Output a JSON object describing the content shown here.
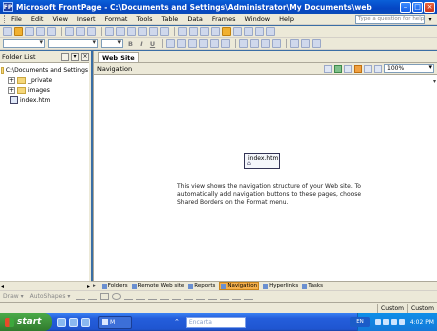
{
  "window": {
    "app_icon": "FP",
    "title": "Microsoft FrontPage - C:\\Documents and Settings\\Administrator\\My Documents\\web",
    "controls": [
      "minimize-icon",
      "maximize-icon",
      "close-icon"
    ]
  },
  "menubar": {
    "items": [
      "File",
      "Edit",
      "View",
      "Insert",
      "Format",
      "Tools",
      "Table",
      "Data",
      "Frames",
      "Window",
      "Help"
    ],
    "help_placeholder": "Type a question for help"
  },
  "folder_list": {
    "title": "Folder List",
    "items": [
      {
        "label": "C:\\Documents and Settings",
        "type": "folder",
        "expander": ""
      },
      {
        "label": "_private",
        "type": "folder",
        "expander": "+"
      },
      {
        "label": "images",
        "type": "folder",
        "expander": "+"
      },
      {
        "label": "index.htm",
        "type": "file",
        "expander": ""
      }
    ]
  },
  "document": {
    "tab_label": "Web Site",
    "view_label": "Navigation",
    "zoom": "100%",
    "nav_node_label": "index.htm",
    "message": "This view shows the navigation structure of your Web site. To automatically add navigation buttons to these pages, choose Shared Borders on the Format menu."
  },
  "view_tabs": [
    {
      "label": "Folders",
      "active": false
    },
    {
      "label": "Remote Web site",
      "active": false
    },
    {
      "label": "Reports",
      "active": false
    },
    {
      "label": "Navigation",
      "active": true
    },
    {
      "label": "Hyperlinks",
      "active": false
    },
    {
      "label": "Tasks",
      "active": false
    }
  ],
  "drawing_bar": {
    "draw_label": "Draw ▾",
    "autoshapes_label": "AutoShapes ▾"
  },
  "statusbar": {
    "cells": [
      "Custom",
      "Custom"
    ]
  },
  "taskbar": {
    "start_label": "start",
    "task_label": "M",
    "encarta_placeholder": "Encarta",
    "lang": "EN",
    "clock": "4:02 PM"
  }
}
